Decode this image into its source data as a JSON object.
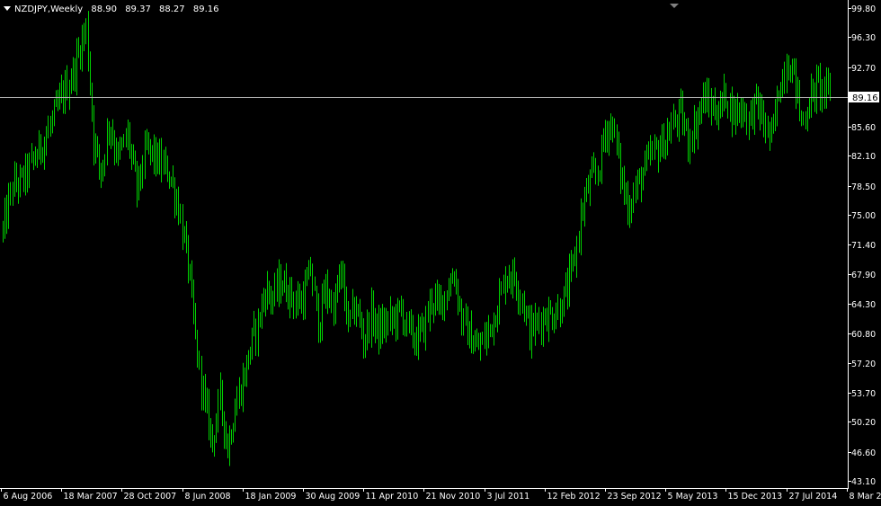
{
  "header": {
    "symbol": "NZDJPY,Weekly",
    "open": "88.90",
    "high": "89.37",
    "low": "88.27",
    "close": "89.16"
  },
  "colors": {
    "background": "#000000",
    "bars": "#00d000",
    "axis": "#ffffff",
    "price_line": "#b0b0b0",
    "price_label_bg": "#ffffff",
    "price_label_text": "#000000"
  },
  "chart_data": {
    "type": "ohlc",
    "symbol": "NZDJPY",
    "timeframe": "Weekly",
    "ylim": [
      43.1,
      99.8
    ],
    "y_ticks": [
      99.8,
      96.3,
      92.7,
      89.16,
      85.6,
      82.1,
      78.5,
      75.0,
      71.4,
      67.9,
      64.3,
      60.8,
      57.2,
      53.7,
      50.2,
      46.6,
      43.1
    ],
    "y_tick_labels": [
      "99.80",
      "96.30",
      "92.70",
      "89.16",
      "85.60",
      "82.10",
      "78.50",
      "75.00",
      "71.40",
      "67.90",
      "64.30",
      "60.80",
      "57.20",
      "53.70",
      "50.20",
      "46.60",
      "43.10"
    ],
    "current_price": 89.16,
    "current_price_label": "89.16",
    "x_tick_labels": [
      "6 Aug 2006",
      "18 Mar 2007",
      "28 Oct 2007",
      "8 Jun 2008",
      "18 Jan 2009",
      "30 Aug 2009",
      "11 Apr 2010",
      "21 Nov 2010",
      "3 Jul 2011",
      "12 Feb 2012",
      "23 Sep 2012",
      "5 May 2013",
      "15 Dec 2013",
      "27 Jul 2014",
      "8 Mar 2015"
    ],
    "bars_per_tick": 32,
    "x_tick_bar_index": [
      -1,
      31,
      63,
      95,
      127,
      159,
      191,
      223,
      255,
      287,
      319,
      351,
      383,
      415,
      447
    ],
    "path_anchors": [
      [
        0,
        73.0
      ],
      [
        5,
        78.5
      ],
      [
        10,
        79.0
      ],
      [
        16,
        81.5
      ],
      [
        22,
        84.0
      ],
      [
        30,
        88.5
      ],
      [
        37,
        92.0
      ],
      [
        44,
        97.5
      ],
      [
        48,
        84.0
      ],
      [
        52,
        80.0
      ],
      [
        56,
        86.0
      ],
      [
        61,
        82.0
      ],
      [
        66,
        84.5
      ],
      [
        71,
        78.0
      ],
      [
        76,
        83.0
      ],
      [
        82,
        81.5
      ],
      [
        88,
        80.0
      ],
      [
        93,
        76.0
      ],
      [
        98,
        69.0
      ],
      [
        103,
        58.0
      ],
      [
        107,
        52.0
      ],
      [
        111,
        48.0
      ],
      [
        115,
        53.0
      ],
      [
        119,
        47.0
      ],
      [
        123,
        52.0
      ],
      [
        127,
        55.0
      ],
      [
        131,
        59.0
      ],
      [
        135,
        62.0
      ],
      [
        139,
        66.0
      ],
      [
        143,
        65.0
      ],
      [
        147,
        67.0
      ],
      [
        151,
        66.0
      ],
      [
        155,
        64.5
      ],
      [
        159,
        65.0
      ],
      [
        163,
        68.5
      ],
      [
        167,
        62.0
      ],
      [
        171,
        66.0
      ],
      [
        175,
        64.0
      ],
      [
        179,
        68.0
      ],
      [
        183,
        62.0
      ],
      [
        187,
        64.0
      ],
      [
        191,
        60.0
      ],
      [
        195,
        63.0
      ],
      [
        199,
        61.0
      ],
      [
        203,
        62.0
      ],
      [
        207,
        62.5
      ],
      [
        211,
        63.5
      ],
      [
        215,
        61.0
      ],
      [
        219,
        60.0
      ],
      [
        223,
        61.5
      ],
      [
        227,
        65.0
      ],
      [
        231,
        64.0
      ],
      [
        235,
        66.0
      ],
      [
        239,
        68.0
      ],
      [
        243,
        62.5
      ],
      [
        247,
        60.5
      ],
      [
        251,
        59.0
      ],
      [
        255,
        60.0
      ],
      [
        259,
        62.0
      ],
      [
        263,
        65.0
      ],
      [
        267,
        68.0
      ],
      [
        271,
        67.5
      ],
      [
        275,
        65.0
      ],
      [
        279,
        61.0
      ],
      [
        283,
        62.0
      ],
      [
        287,
        63.0
      ],
      [
        291,
        63.0
      ],
      [
        295,
        64.0
      ],
      [
        299,
        66.0
      ],
      [
        303,
        70.0
      ],
      [
        307,
        76.0
      ],
      [
        311,
        79.0
      ],
      [
        315,
        80.0
      ],
      [
        319,
        85.0
      ],
      [
        323,
        86.0
      ],
      [
        327,
        80.0
      ],
      [
        331,
        76.0
      ],
      [
        335,
        78.0
      ],
      [
        339,
        80.0
      ],
      [
        343,
        82.0
      ],
      [
        347,
        83.0
      ],
      [
        351,
        84.0
      ],
      [
        355,
        86.0
      ],
      [
        359,
        87.0
      ],
      [
        363,
        84.0
      ],
      [
        367,
        86.0
      ],
      [
        371,
        89.0
      ],
      [
        375,
        88.0
      ],
      [
        379,
        87.5
      ],
      [
        383,
        89.5
      ],
      [
        387,
        87.0
      ],
      [
        391,
        88.0
      ],
      [
        395,
        86.5
      ],
      [
        399,
        88.5
      ],
      [
        403,
        86.0
      ],
      [
        407,
        84.0
      ],
      [
        411,
        90.0
      ],
      [
        415,
        93.5
      ],
      [
        419,
        92.0
      ],
      [
        423,
        86.0
      ],
      [
        427,
        88.5
      ],
      [
        431,
        90.5
      ],
      [
        435,
        90.0
      ],
      [
        438,
        89.16
      ]
    ]
  }
}
